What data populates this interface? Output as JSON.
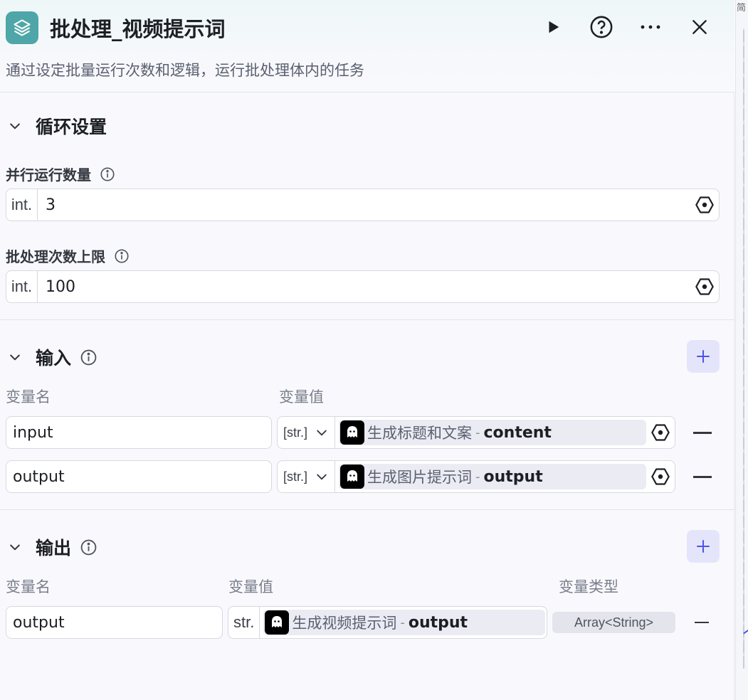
{
  "side_strip": {
    "char": "简"
  },
  "header": {
    "title": "批处理_视频提示词",
    "description": "通过设定批量运行次数和逻辑，运行批处理体内的任务"
  },
  "loop_settings": {
    "title": "循环设置",
    "parallel_label": "并行运行数量",
    "parallel_type": "int.",
    "parallel_value": "3",
    "limit_label": "批处理次数上限",
    "limit_type": "int.",
    "limit_value": "100"
  },
  "inputs": {
    "title": "输入",
    "col_name": "变量名",
    "col_value": "变量值",
    "rows": [
      {
        "name": "input",
        "type": "[str.]",
        "node": "生成标题和文案",
        "sep": "-",
        "var": "content"
      },
      {
        "name": "output",
        "type": "[str.]",
        "node": "生成图片提示词",
        "sep": "-",
        "var": "output"
      }
    ]
  },
  "outputs": {
    "title": "输出",
    "col_name": "变量名",
    "col_value": "变量值",
    "col_type": "变量类型",
    "rows": [
      {
        "name": "output",
        "type": "str.",
        "node": "生成视频提示词",
        "sep": "-",
        "var": "output",
        "var_type": "Array<String>"
      }
    ]
  },
  "colors": {
    "accent": "#4d53e8",
    "node_icon": "#4ea6a8",
    "add_bg": "#e4e5fb"
  },
  "icons": [
    "layers-icon",
    "play-icon",
    "help-icon",
    "more-icon",
    "close-icon",
    "chevron-down-icon",
    "info-icon",
    "hexagon-icon",
    "plus-icon",
    "minus-icon",
    "bot-icon"
  ]
}
